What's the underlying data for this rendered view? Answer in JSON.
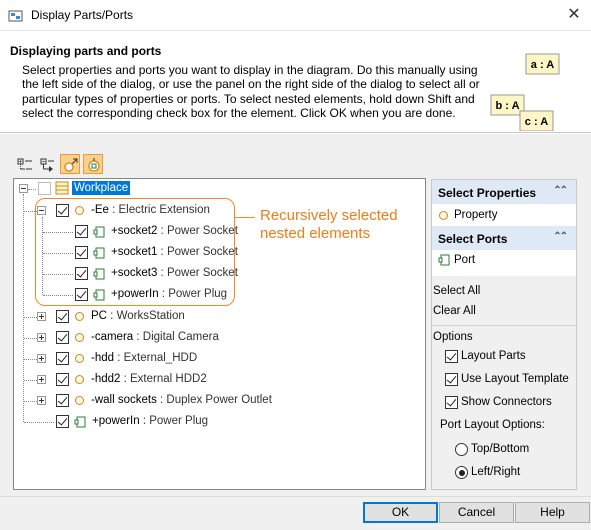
{
  "window": {
    "title": "Display Parts/Ports",
    "close_glyph": "✕"
  },
  "header": {
    "title": "Displaying parts and ports",
    "description": "Select properties and ports you want to display in the diagram. Do this manually using the left side of the dialog, or use the panel on the right side of the dialog to select all or particular types of properties or ports. To select nested elements, hold down Shift and select the corresponding check box for the element. Click OK when you are done.",
    "decoration_labels": [
      "a : A",
      "b : A",
      "c : A"
    ]
  },
  "tree": {
    "root": {
      "name": "Workplace",
      "checked": false
    },
    "items": [
      {
        "name": "-Ee",
        "type": "Electric Extension",
        "checked": true,
        "kind": "property",
        "expander": "minus"
      },
      {
        "name": "+socket2",
        "type": "Power Socket",
        "checked": true,
        "kind": "port"
      },
      {
        "name": "+socket1",
        "type": "Power Socket",
        "checked": true,
        "kind": "port"
      },
      {
        "name": "+socket3",
        "type": "Power Socket",
        "checked": true,
        "kind": "port"
      },
      {
        "name": "+powerIn",
        "type": "Power Plug",
        "checked": true,
        "kind": "port"
      },
      {
        "name": "PC",
        "type": "WorksStation",
        "checked": true,
        "kind": "property",
        "expander": "plus"
      },
      {
        "name": "-camera",
        "type": "Digital Camera",
        "checked": true,
        "kind": "property",
        "expander": "plus"
      },
      {
        "name": "-hdd",
        "type": "External_HDD",
        "checked": true,
        "kind": "property",
        "expander": "plus"
      },
      {
        "name": "-hdd2",
        "type": "External HDD2",
        "checked": true,
        "kind": "property",
        "expander": "plus"
      },
      {
        "name": "-wall sockets",
        "type": "Duplex Power Outlet",
        "checked": true,
        "kind": "property",
        "expander": "plus"
      },
      {
        "name": "+powerIn",
        "type": "Power Plug",
        "checked": true,
        "kind": "port"
      }
    ],
    "type_separator": " : "
  },
  "callout": {
    "text": "Recursively selected nested elements"
  },
  "panel": {
    "select_properties": {
      "title": "Select Properties",
      "item": "Property"
    },
    "select_ports": {
      "title": "Select Ports",
      "item": "Port"
    },
    "select_all": "Select All",
    "clear_all": "Clear All",
    "options": {
      "title": "Options",
      "layout_parts": {
        "label": "Layout Parts",
        "checked": true
      },
      "use_layout_template": {
        "label": "Use Layout Template",
        "checked": true
      },
      "show_connectors": {
        "label": "Show Connectors",
        "checked": true
      }
    },
    "port_layout": {
      "title": "Port Layout Options:",
      "top_bottom": {
        "label": "Top/Bottom",
        "selected": false
      },
      "left_right": {
        "label": "Left/Right",
        "selected": true
      }
    },
    "chevron": "⌃⌃"
  },
  "buttons": {
    "ok": "OK",
    "cancel": "Cancel",
    "help": "Help"
  },
  "colors": {
    "accent": "#0078d7",
    "callout": "#ef8a2e",
    "panel_header": "#dfe9f5",
    "toggle_on": "#fbd08d"
  },
  "toolbar": {
    "icons": [
      "expand-all-icon",
      "collapse-all-icon",
      "show-properties-icon",
      "show-ports-icon"
    ]
  }
}
